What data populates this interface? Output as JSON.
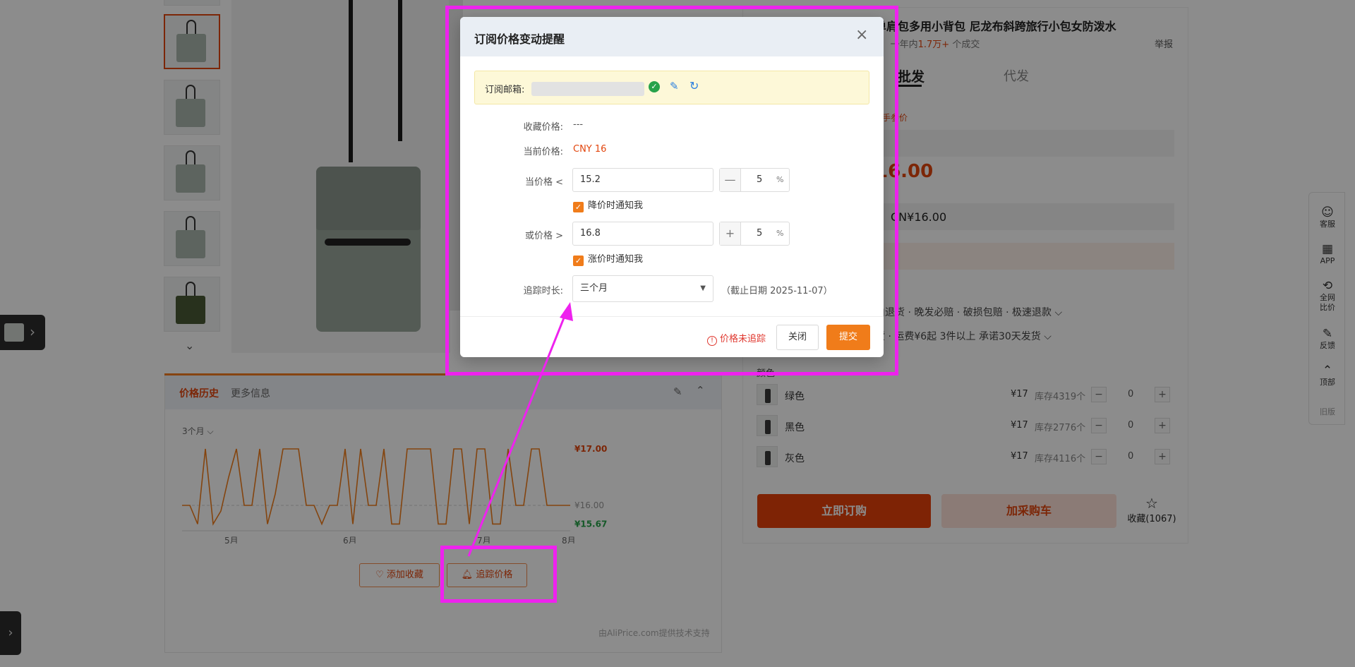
{
  "product": {
    "title": "单肩包多用小背包 尼龙布斜跨旅行小包女防泼水",
    "sub_suffix": ")",
    "sub_prefix": "一年内",
    "sold": "1.7万+",
    "sold_suffix": " 个成交",
    "report": "举报",
    "tab_wholesale": "批发",
    "tab_dropship": "代发",
    "hand_price_note": "手参价",
    "price_partial": "16.00",
    "price_band": "CN¥16.00",
    "services_1": "由退货 · 晚发必赔 · 破损包赔 · 极速退款 ⌵",
    "services_2": "货 · 运费¥6起  3件以上  承诺30天发货 ⌵",
    "color_label": "颜色",
    "variants": [
      {
        "name": "绿色",
        "price": "¥17",
        "stock": "库存4319个",
        "qty": "0"
      },
      {
        "name": "黑色",
        "price": "¥17",
        "stock": "库存2776个",
        "qty": "0"
      },
      {
        "name": "灰色",
        "price": "¥17",
        "stock": "库存4116个",
        "qty": "0"
      }
    ],
    "buy_now": "立即订购",
    "add_cart": "加采购车",
    "favorite": "收藏(1067)"
  },
  "sidebar": {
    "items": [
      {
        "icon": "customer-service-icon",
        "label": "客服"
      },
      {
        "icon": "qr-app-icon",
        "label": "APP"
      },
      {
        "icon": "compare-icon",
        "label": "全网比价"
      },
      {
        "icon": "feedback-icon",
        "label": "反馈"
      },
      {
        "icon": "back-to-top-icon",
        "label": "顶部"
      },
      {
        "icon": "",
        "label": "旧版"
      }
    ]
  },
  "history": {
    "tab_history": "价格历史",
    "tab_more": "更多信息",
    "period": "3个月 ⌵",
    "add_favorite": "♡ 添加收藏",
    "track_price": "追踪价格",
    "credit": "由AliPrice.com提供技术支持"
  },
  "chart_data": {
    "type": "line",
    "title": "",
    "xlabel": "",
    "ylabel": "",
    "ylim": [
      15.6,
      17.05
    ],
    "x_ticks": [
      "5月",
      "6月",
      "7月",
      "8月"
    ],
    "y_tick_labels": [
      {
        "label": "¥17.00",
        "value": 17.0,
        "color": "#e2450d"
      },
      {
        "label": "¥16.00",
        "value": 16.0,
        "color": "#999999"
      },
      {
        "label": "¥15.67",
        "value": 15.67,
        "color": "#27a24a"
      }
    ],
    "series": [
      {
        "color": "#f07c1a",
        "values": [
          16.0,
          16.0,
          15.67,
          17.0,
          15.67,
          15.9,
          16.5,
          17.0,
          16.0,
          16.0,
          17.0,
          15.67,
          16.2,
          17.0,
          17.0,
          17.0,
          16.0,
          16.0,
          15.67,
          16.0,
          16.0,
          17.0,
          15.67,
          17.0,
          16.0,
          16.0,
          17.0,
          15.67,
          15.67,
          17.0,
          17.0,
          17.0,
          17.0,
          15.67,
          15.67,
          17.0,
          17.0,
          15.67,
          17.0,
          17.0,
          15.67,
          15.67,
          17.0,
          16.0,
          16.0,
          17.0,
          17.0,
          16.0,
          16.0,
          16.0,
          16.0
        ]
      }
    ]
  },
  "dialog": {
    "title": "订阅价格变动提醒",
    "email_label": "订阅邮箱:",
    "fav_price_label": "收藏价格:",
    "fav_price_value": "---",
    "cur_price_label": "当前价格:",
    "cur_price_value": "CNY  16",
    "lt_label": "当价格 <",
    "lt_value": "15.2",
    "lt_sign": "—",
    "lt_pct": "5",
    "pct_unit": "%",
    "lt_notify": "降价时通知我",
    "gt_label": "或价格 >",
    "gt_value": "16.8",
    "gt_sign": "+",
    "gt_pct": "5",
    "gt_notify": "涨价时通知我",
    "duration_label": "追踪时长:",
    "duration_value": "三个月",
    "deadline": "（截止日期 2025-11-07）",
    "untracked": "价格未追踪",
    "close": "关闭",
    "submit": "提交"
  },
  "colors": {
    "accent": "#f07c1a",
    "brand_red": "#e2450d",
    "annotation": "#ee22ee"
  }
}
